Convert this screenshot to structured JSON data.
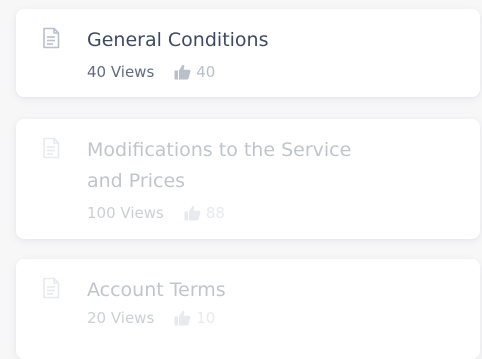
{
  "colors": {
    "title": "#3e4a63",
    "views": "#5f6b80",
    "likes": "#b8c0cc",
    "icon": "#b8c0cc",
    "card_bg": "#ffffff",
    "page_bg": "#f7f7f8"
  },
  "articles": [
    {
      "title": "General Conditions",
      "views": "40 Views",
      "likes": "40",
      "icon": "document-icon",
      "like_icon": "thumbs-up-icon"
    },
    {
      "title": "Modifications to the Service and Prices",
      "views": "100 Views",
      "likes": "88",
      "icon": "document-icon",
      "like_icon": "thumbs-up-icon"
    },
    {
      "title": "Account Terms",
      "views": "20 Views",
      "likes": "10",
      "icon": "document-icon",
      "like_icon": "thumbs-up-icon"
    }
  ]
}
